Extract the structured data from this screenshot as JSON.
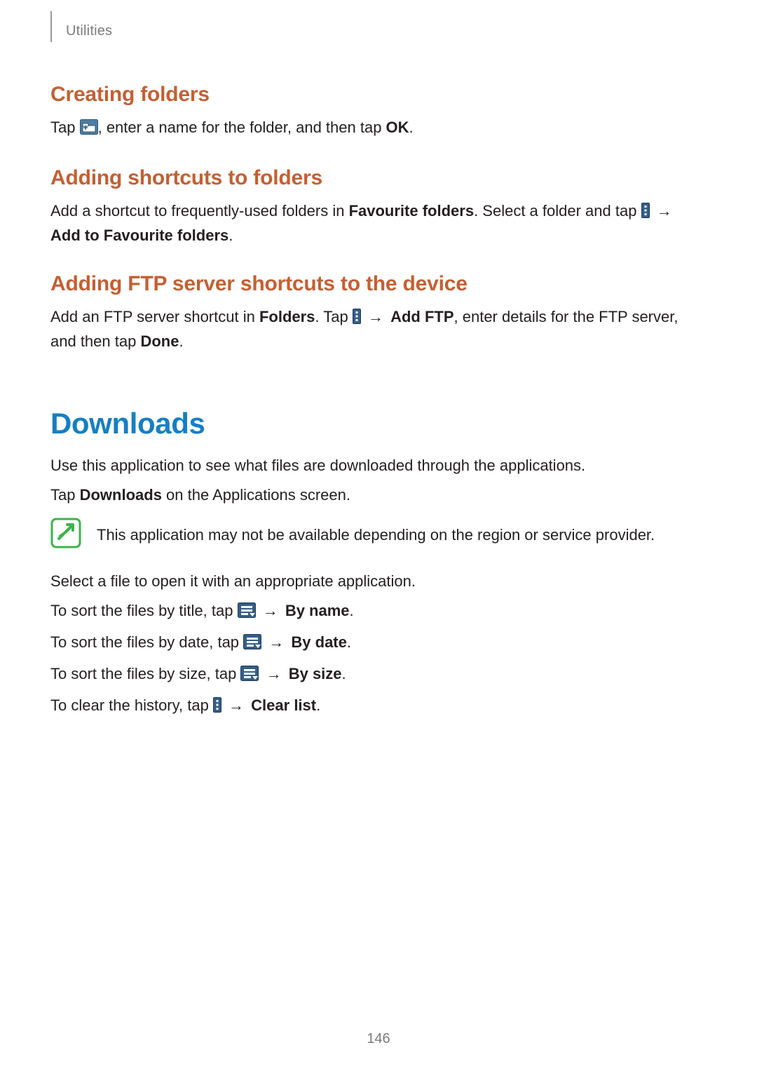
{
  "header": {
    "section": "Utilities"
  },
  "s1": {
    "title": "Creating folders",
    "p1a": "Tap ",
    "p1b": ", enter a name for the folder, and then tap ",
    "p1c": "OK",
    "p1d": "."
  },
  "s2": {
    "title": "Adding shortcuts to folders",
    "p1a": "Add a shortcut to frequently-used folders in ",
    "p1b": "Favourite folders",
    "p1c": ". Select a folder and tap ",
    "p1d": " → ",
    "p1e": "Add to Favourite folders",
    "p1f": "."
  },
  "s3": {
    "title": "Adding FTP server shortcuts to the device",
    "p1a": "Add an FTP server shortcut in ",
    "p1b": "Folders",
    "p1c": ". Tap ",
    "p1d": " → ",
    "p1e": "Add FTP",
    "p1f": ", enter details for the FTP server, and then tap ",
    "p1g": "Done",
    "p1h": "."
  },
  "dl": {
    "title": "Downloads",
    "intro1": "Use this application to see what files are downloaded through the applications.",
    "intro2a": "Tap ",
    "intro2b": "Downloads",
    "intro2c": " on the Applications screen.",
    "note": "This application may not be available depending on the region or service provider.",
    "p1": "Select a file to open it with an appropriate application.",
    "sortTitleA": "To sort the files by title, tap ",
    "sortTitleB": " → ",
    "sortTitleC": "By name",
    "sortTitleD": ".",
    "sortDateA": "To sort the files by date, tap ",
    "sortDateB": " → ",
    "sortDateC": "By date",
    "sortDateD": ".",
    "sortSizeA": "To sort the files by size, tap ",
    "sortSizeB": " → ",
    "sortSizeC": "By size",
    "sortSizeD": ".",
    "clearA": "To clear the history, tap ",
    "clearB": " → ",
    "clearC": "Clear list",
    "clearD": "."
  },
  "page_number": "146"
}
